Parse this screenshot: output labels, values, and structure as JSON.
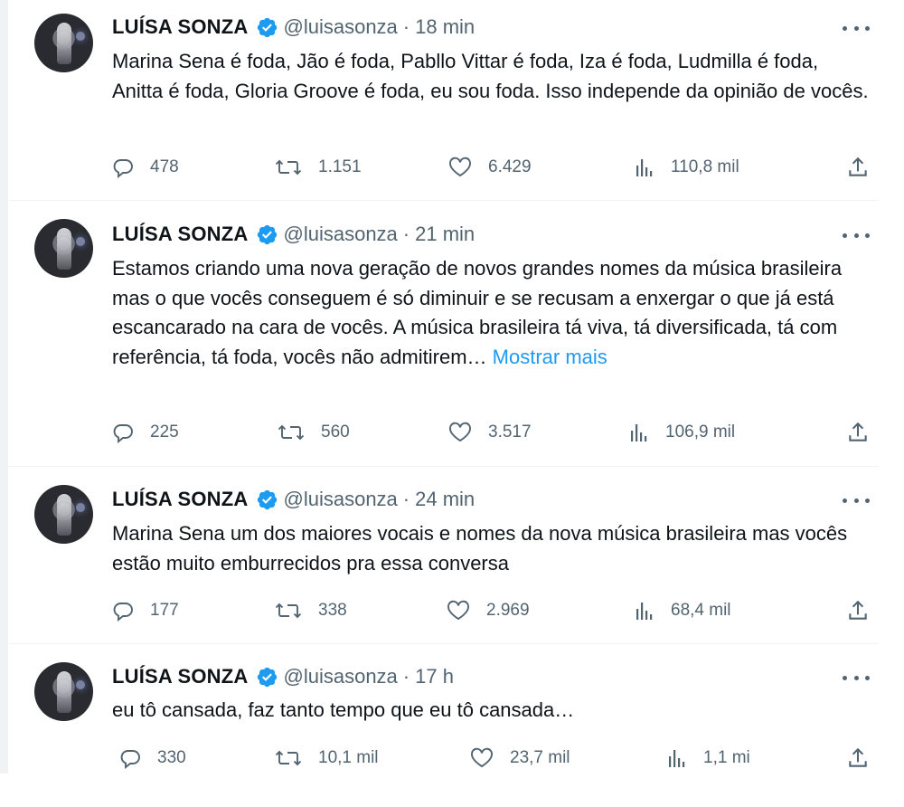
{
  "tweets": [
    {
      "name": "LUÍSA SONZA",
      "handle": "@luisasonza",
      "time": "18 min",
      "text": "Marina Sena é foda, Jão é foda, Pabllo Vittar é foda, Iza é foda, Ludmilla é foda, Anitta é foda, Gloria Groove é foda, eu sou foda.  Isso independe da opinião de vocês.",
      "show_more": "",
      "replies": "478",
      "retweets": "1.151",
      "likes": "6.429",
      "views": "110,8 mil"
    },
    {
      "name": "LUÍSA SONZA",
      "handle": "@luisasonza",
      "time": "21 min",
      "text": "Estamos criando uma nova geração de novos grandes nomes da música brasileira mas o que vocês conseguem é só diminuir e se recusam a enxergar o que já está escancarado na cara de vocês. A música brasileira tá viva, tá diversificada, tá com referência, tá foda, vocês não admitirem…",
      "show_more": "Mostrar mais",
      "replies": "225",
      "retweets": "560",
      "likes": "3.517",
      "views": "106,9 mil"
    },
    {
      "name": "LUÍSA SONZA",
      "handle": "@luisasonza",
      "time": "24 min",
      "text": "Marina Sena um dos maiores vocais e nomes da nova música brasileira mas vocês estão muito emburrecidos pra essa conversa",
      "show_more": "",
      "replies": "177",
      "retweets": "338",
      "likes": "2.969",
      "views": "68,4 mil"
    },
    {
      "name": "LUÍSA SONZA",
      "handle": "@luisasonza",
      "time": "17 h",
      "text": "eu tô cansada, faz tanto tempo que eu tô cansada…",
      "show_more": "",
      "replies": "330",
      "retweets": "10,1 mil",
      "likes": "23,7 mil",
      "views": "1,1 mi"
    }
  ],
  "icons": {
    "verified": "verified-badge-icon",
    "more": "more-options-icon",
    "reply": "reply-icon",
    "retweet": "retweet-icon",
    "like": "like-icon",
    "views": "views-icon",
    "share": "share-icon"
  },
  "colors": {
    "verified": "#1d9bf0",
    "link": "#1d9bf0",
    "muted": "#536471"
  }
}
